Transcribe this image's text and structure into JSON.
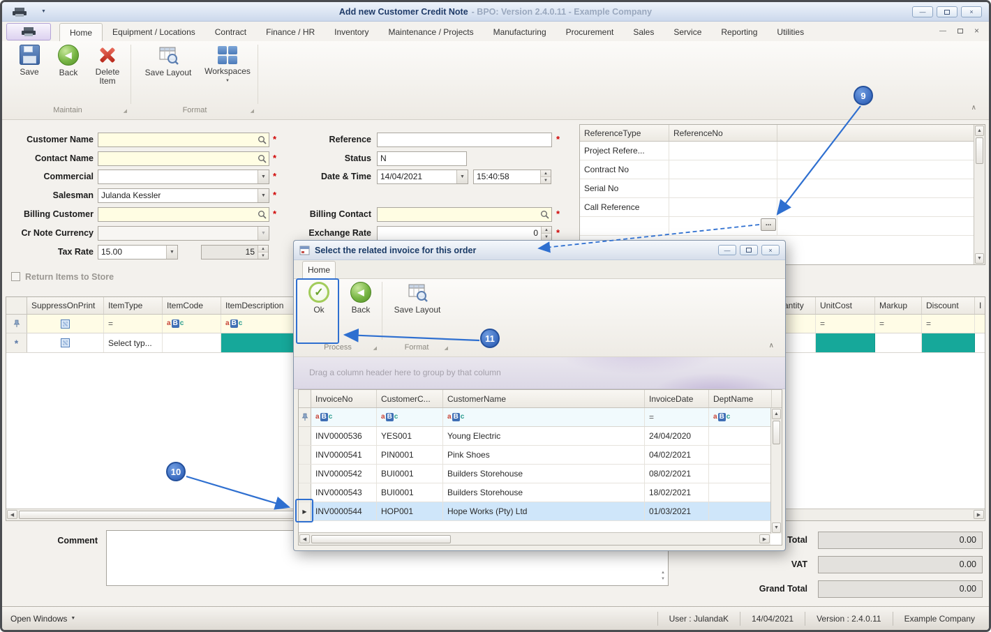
{
  "window": {
    "title": "Add new Customer Credit Note",
    "subtitle": "- BPO: Version 2.4.0.11 - Example Company"
  },
  "ribbon": {
    "tabs": [
      "Home",
      "Equipment / Locations",
      "Contract",
      "Finance / HR",
      "Inventory",
      "Maintenance / Projects",
      "Manufacturing",
      "Procurement",
      "Sales",
      "Service",
      "Reporting",
      "Utilities"
    ],
    "buttons": {
      "save": "Save",
      "back": "Back",
      "delete_item": "Delete Item",
      "save_layout": "Save Layout",
      "workspaces": "Workspaces"
    },
    "groups": {
      "maintain": "Maintain",
      "format": "Format"
    }
  },
  "form": {
    "customer_name_label": "Customer Name",
    "contact_name_label": "Contact Name",
    "commercial_label": "Commercial",
    "salesman_label": "Salesman",
    "salesman_value": "Julanda Kessler",
    "billing_customer_label": "Billing Customer",
    "cr_note_currency_label": "Cr Note Currency",
    "tax_rate_label": "Tax Rate",
    "tax_rate_value": "15.00",
    "tax_rate_spin": "15",
    "return_items_label": "Return Items to Store",
    "reference_label": "Reference",
    "status_label": "Status",
    "status_value": "N",
    "date_time_label": "Date & Time",
    "date_value": "14/04/2021",
    "time_value": "15:40:58",
    "billing_contact_label": "Billing Contact",
    "exchange_rate_label": "Exchange Rate",
    "exchange_rate_value": "0"
  },
  "reference_grid": {
    "col_type": "ReferenceType",
    "col_no": "ReferenceNo",
    "rows": [
      "Project Refere...",
      "Contract No",
      "Serial No",
      "Call Reference"
    ],
    "browse": "..."
  },
  "item_grid": {
    "columns": [
      "SuppressOnPrint",
      "ItemType",
      "ItemCode",
      "ItemDescription",
      "Quantity",
      "UnitCost",
      "Markup",
      "Discount",
      "I"
    ],
    "new_row_prompt": "Select typ..."
  },
  "dialog": {
    "title": "Select the related invoice for this order",
    "tab": "Home",
    "buttons": {
      "ok": "Ok",
      "back": "Back",
      "save_layout": "Save Layout"
    },
    "groups": {
      "process": "Process",
      "format": "Format"
    },
    "groupby_hint": "Drag a column header here to group by that column",
    "columns": [
      "InvoiceNo",
      "CustomerC...",
      "CustomerName",
      "InvoiceDate",
      "DeptName"
    ],
    "rows": [
      {
        "invoice_no": "INV0000536",
        "customer_code": "YES001",
        "customer_name": "Young Electric",
        "invoice_date": "24/04/2020"
      },
      {
        "invoice_no": "INV0000541",
        "customer_code": "PIN0001",
        "customer_name": "Pink Shoes",
        "invoice_date": "04/02/2021"
      },
      {
        "invoice_no": "INV0000542",
        "customer_code": "BUI0001",
        "customer_name": "Builders Storehouse",
        "invoice_date": "08/02/2021"
      },
      {
        "invoice_no": "INV0000543",
        "customer_code": "BUI0001",
        "customer_name": "Builders Storehouse",
        "invoice_date": "18/02/2021"
      },
      {
        "invoice_no": "INV0000544",
        "customer_code": "HOP001",
        "customer_name": "Hope Works (Pty) Ltd",
        "invoice_date": "01/03/2021"
      }
    ]
  },
  "footer": {
    "comment_label": "Comment",
    "total_label": "Total",
    "total_value": "0.00",
    "vat_label": "VAT",
    "vat_value": "0.00",
    "grand_total_label": "Grand Total",
    "grand_total_value": "0.00"
  },
  "statusbar": {
    "open_windows": "Open Windows",
    "user": "User : JulandaK",
    "date": "14/04/2021",
    "version": "Version : 2.4.0.11",
    "company": "Example Company"
  },
  "callouts": {
    "n9": "9",
    "n10": "10",
    "n11": "11"
  },
  "glyphs": {
    "dropdown": "▼",
    "up": "▲",
    "down": "▼",
    "left": "◀",
    "right": "▶",
    "minimize": "—",
    "close": "×",
    "check": "✓",
    "back_arrow": "◀",
    "collapse": "∧",
    "equals": "=",
    "new_row": "*",
    "row_selector": "▶",
    "required": "*",
    "abc_a": "a",
    "abc_b": "B",
    "abc_c": "c"
  },
  "colors": {
    "accent_blue": "#2e6fd0",
    "required_red": "#d00000",
    "teal_cell": "#16a89a",
    "selected_row": "#cfe6fa"
  }
}
